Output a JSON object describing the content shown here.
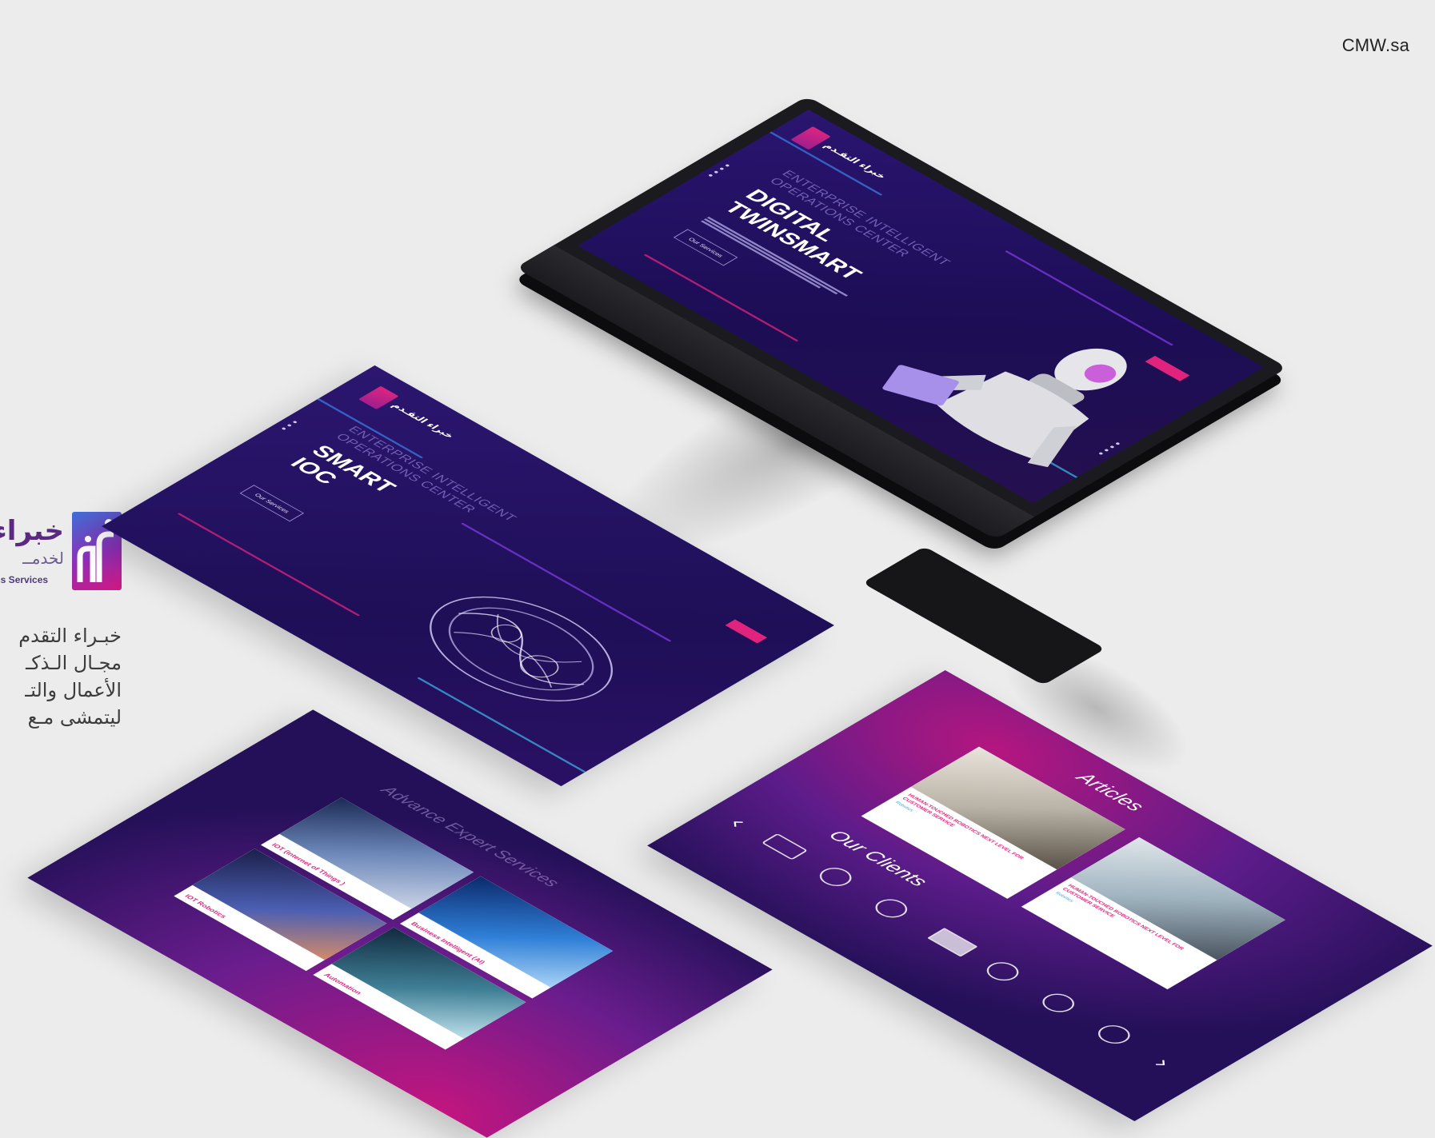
{
  "site": "CMW.sa",
  "brand": {
    "arabic_title": "خبراء",
    "arabic_subtitle": "لخدمــ",
    "english_tagline": "ness Services"
  },
  "intro": [
    "خبـراء التقدم",
    "مجـال الـذكـ",
    "الأعمال والتـ",
    "ليتمشى مـع"
  ],
  "monitor_screen": {
    "logo_ar": "خبراء التقـدم",
    "nav": [
      "",
      "",
      "",
      "",
      ""
    ],
    "kicker_line1": "ENTERPRISE INTELLIGENT",
    "kicker_line2": "OPERATIONS CENTER",
    "title_line1": "DIGITAL",
    "title_line2": "TWINSMART",
    "button": "Our Services"
  },
  "hero_sheet": {
    "logo_ar": "خبراء التقـدم",
    "kicker_line1": "ENTERPRISE INTELLIGENT",
    "kicker_line2": "OPERATIONS CENTER",
    "title_line1": "SMART",
    "title_line2": "IOC",
    "button": "Our Services"
  },
  "services_sheet": {
    "title": "Advance Expert Services",
    "cards": [
      {
        "label": "IOT (Internet of Things )"
      },
      {
        "label": "IOT Robotics"
      },
      {
        "label": "Business Intelligent (AI)"
      },
      {
        "label": "Automation"
      }
    ]
  },
  "clients_sheet": {
    "articles_title": "Articles",
    "clients_title": "Our Clients",
    "articles": [
      {
        "headline": "HUMAN-TOUCHED ROBOTICS NEXT LEVEL FOR CUSTOMER SERVICE",
        "tag": "Robotics"
      },
      {
        "headline": "HUMAN-TOUCHED ROBOTICS NEXT LEVEL FOR CUSTOMER SERVICE",
        "tag": "Robotics"
      }
    ],
    "prev_icon": "chevron-left-icon",
    "next_icon": "chevron-right-icon"
  },
  "colors": {
    "accent_pink": "#e0247e",
    "deep_purple": "#1e0f57",
    "page_bg": "#ececec"
  }
}
